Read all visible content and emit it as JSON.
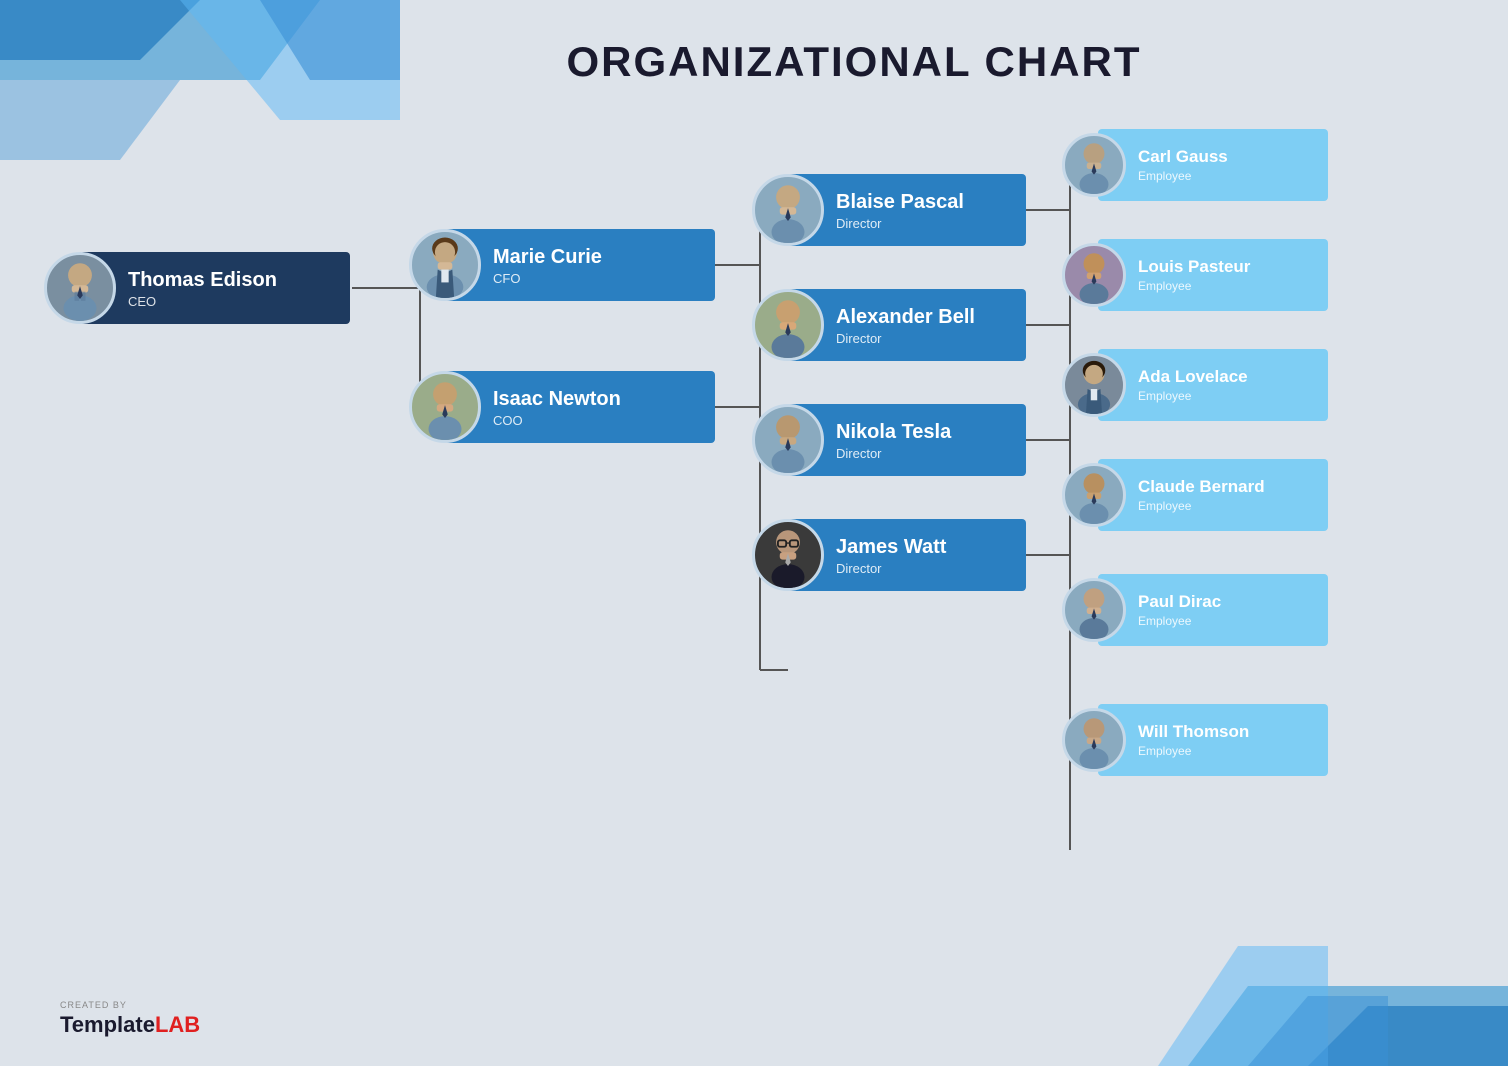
{
  "page": {
    "title": "ORGANIZATIONAL CHART",
    "background_color": "#dde3ea"
  },
  "branding": {
    "created_by": "CREATED BY",
    "name_plain": "Template",
    "name_bold": "LAB"
  },
  "nodes": {
    "ceo": {
      "name": "Thomas Edison",
      "title": "CEO",
      "type": "dark",
      "avatar": "male"
    },
    "cfo": {
      "name": "Marie Curie",
      "title": "CFO",
      "type": "blue",
      "avatar": "female"
    },
    "coo": {
      "name": "Isaac Newton",
      "title": "COO",
      "type": "blue",
      "avatar": "male2"
    },
    "dir1": {
      "name": "Blaise Pascal",
      "title": "Director",
      "type": "blue",
      "avatar": "male"
    },
    "dir2": {
      "name": "Alexander Bell",
      "title": "Director",
      "type": "blue",
      "avatar": "male3"
    },
    "dir3": {
      "name": "Nikola Tesla",
      "title": "Director",
      "type": "blue",
      "avatar": "male"
    },
    "dir4": {
      "name": "James Watt",
      "title": "Director",
      "type": "blue",
      "avatar": "glasses"
    },
    "emp1": {
      "name": "Carl Gauss",
      "title": "Employee",
      "type": "light"
    },
    "emp2": {
      "name": "Louis Pasteur",
      "title": "Employee",
      "type": "light"
    },
    "emp3": {
      "name": "Ada Lovelace",
      "title": "Employee",
      "type": "light"
    },
    "emp4": {
      "name": "Claude Bernard",
      "title": "Employee",
      "type": "light"
    },
    "emp5": {
      "name": "Paul Dirac",
      "title": "Employee",
      "type": "light"
    },
    "emp6": {
      "name": "Will Thomson",
      "title": "Employee",
      "type": "light"
    }
  }
}
